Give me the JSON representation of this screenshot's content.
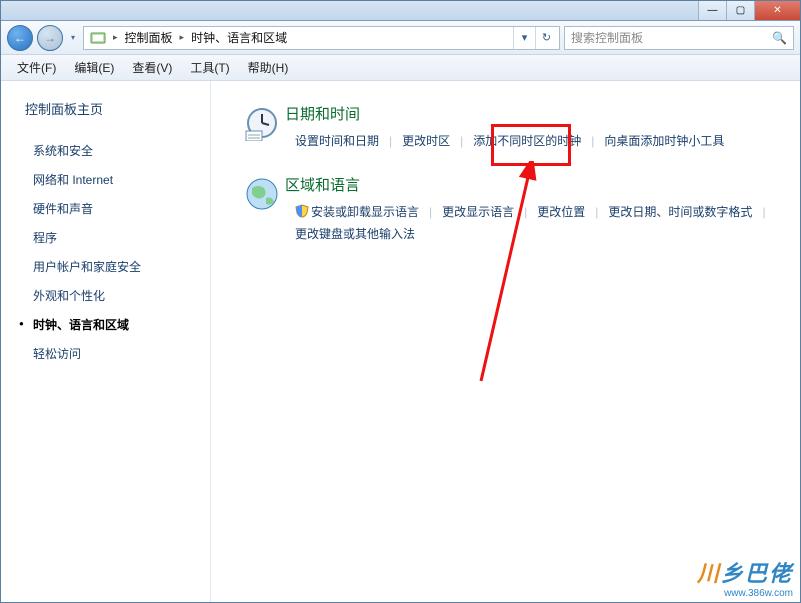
{
  "titlebar": {
    "min": "—",
    "max": "▢",
    "close": "✕"
  },
  "nav": {
    "back": "←",
    "forward": "→"
  },
  "address": {
    "seg1": "控制面板",
    "seg2": "时钟、语言和区域",
    "chev": "▸",
    "dropdown": "▾",
    "refresh": "↻"
  },
  "search": {
    "placeholder": "搜索控制面板",
    "icon": "🔍"
  },
  "menu": {
    "file": "文件(F)",
    "edit": "编辑(E)",
    "view": "查看(V)",
    "tools": "工具(T)",
    "help": "帮助(H)"
  },
  "sidebar": {
    "home": "控制面板主页",
    "items": [
      "系统和安全",
      "网络和 Internet",
      "硬件和声音",
      "程序",
      "用户帐户和家庭安全",
      "外观和个性化",
      "时钟、语言和区域",
      "轻松访问"
    ],
    "active_index": 6
  },
  "groups": [
    {
      "title": "日期和时间",
      "links": [
        "设置时间和日期",
        "更改时区",
        "添加不同时区的时钟",
        "向桌面添加时钟小工具"
      ],
      "shield_index": -1
    },
    {
      "title": "区域和语言",
      "links": [
        "安装或卸载显示语言",
        "更改显示语言",
        "更改位置",
        "更改日期、时间或数字格式",
        "更改键盘或其他输入法"
      ],
      "shield_index": 0
    }
  ],
  "watermark": {
    "text1": "乡巴佬",
    "url": "www.386w.com"
  }
}
